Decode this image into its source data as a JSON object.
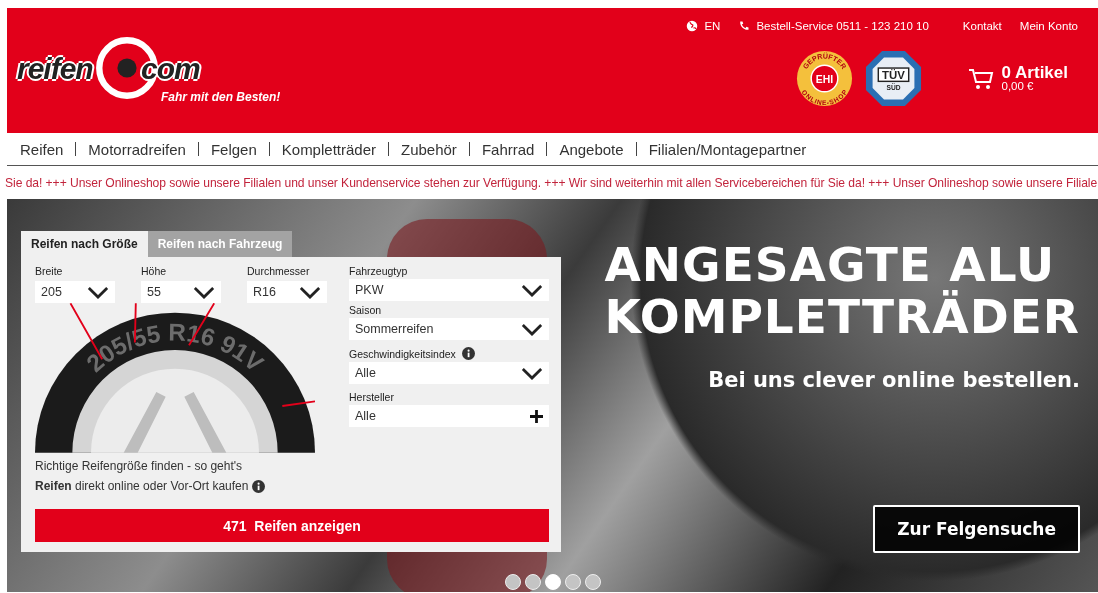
{
  "header": {
    "logo": {
      "word_1": "reifen",
      "word_2": "com",
      "slogan": "Fahr mit den Besten!"
    },
    "top_links": [
      {
        "kind": "language",
        "label": "EN"
      },
      {
        "kind": "phone",
        "label": "Bestell-Service 0511 - 123 210 10"
      },
      {
        "kind": "plain",
        "label": "Kontakt"
      },
      {
        "kind": "plain",
        "label": "Mein Konto"
      }
    ],
    "badges": [
      {
        "kind": "ehi",
        "ring_top": "GEPRÜFTER",
        "ring_bottom": "ONLINE-SHOP",
        "center": "EHI"
      },
      {
        "kind": "tuv",
        "center": "TÜV",
        "sub": "SÜD"
      }
    ],
    "cart": {
      "count": "0 Artikel",
      "total": "0,00 €"
    }
  },
  "nav": [
    "Reifen",
    "Motorradreifen",
    "Felgen",
    "Kompletträder",
    "Zubehör",
    "Fahrrad",
    "Angebote",
    "Filialen/Montagepartner"
  ],
  "ticker": "Sie da! +++ Unser Onlineshop sowie unsere Filialen und unser Kundenservice stehen zur Verfügung. +++ Wir sind weiterhin mit allen Servicebereichen für Sie da! +++ Unser Onlineshop sowie unsere Filiale",
  "search": {
    "tabs": [
      {
        "label": "Reifen nach Größe",
        "selected": true
      },
      {
        "label": "Reifen nach Fahrzeug",
        "selected": false
      }
    ],
    "size_fields": [
      {
        "label": "Breite",
        "value": "205"
      },
      {
        "label": "Höhe",
        "value": "55"
      },
      {
        "label": "Durchmesser",
        "value": "R16"
      }
    ],
    "tire_marking": "205/55 R16 91V",
    "side_fields": [
      {
        "label": "Fahrzeugtyp",
        "value": "PKW",
        "kind": "select",
        "info": false
      },
      {
        "label": "Saison",
        "value": "Sommerreifen",
        "kind": "select",
        "info": false
      },
      {
        "label": "Geschwindigkeitsindex",
        "value": "Alle",
        "kind": "select",
        "info": true
      },
      {
        "label": "Hersteller",
        "value": "Alle",
        "kind": "add",
        "info": false
      }
    ],
    "help_link": "Richtige Reifengröße finden - so geht's",
    "note": "**Reifen** direkt online oder Vor-Ort kaufen",
    "submit": "471  Reifen anzeigen"
  },
  "hero": {
    "headline_lines": [
      "ANGESAGTE ALU",
      "KOMPLETTRÄDER"
    ],
    "subline": "Bei uns clever online bestellen.",
    "button": "Zur Felgensuche",
    "dots": [
      {
        "selected": false
      },
      {
        "selected": false
      },
      {
        "selected": true
      },
      {
        "selected": false
      },
      {
        "selected": false
      }
    ]
  }
}
